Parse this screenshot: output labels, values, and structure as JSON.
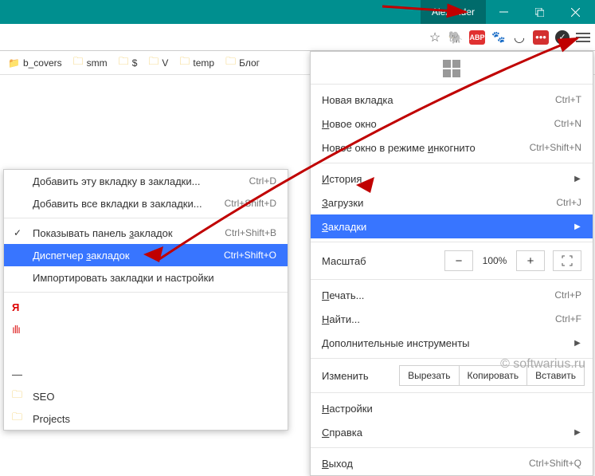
{
  "titlebar": {
    "user": "Alexander"
  },
  "bookmarks_bar": {
    "items": [
      {
        "label": "b_covers"
      },
      {
        "label": "smm"
      },
      {
        "label": "$"
      },
      {
        "label": "V"
      },
      {
        "label": "temp"
      },
      {
        "label": "Блог"
      }
    ]
  },
  "menu": {
    "new_tab": {
      "label": "Новая вкладка",
      "shortcut": "Ctrl+T"
    },
    "new_window": {
      "label": "Новое окно",
      "shortcut": "Ctrl+N"
    },
    "incognito": {
      "label": "Новое окно в режиме инкогнито",
      "shortcut": "Ctrl+Shift+N"
    },
    "history": {
      "label": "История"
    },
    "downloads": {
      "label": "Загрузки",
      "shortcut": "Ctrl+J"
    },
    "bookmarks": {
      "label": "Закладки"
    },
    "zoom": {
      "label": "Масштаб",
      "value": "100%",
      "minus": "−",
      "plus": "+"
    },
    "print": {
      "label": "Печать...",
      "shortcut": "Ctrl+P"
    },
    "find": {
      "label": "Найти...",
      "shortcut": "Ctrl+F"
    },
    "tools": {
      "label": "Дополнительные инструменты"
    },
    "edit": {
      "label": "Изменить",
      "cut": "Вырезать",
      "copy": "Копировать",
      "paste": "Вставить"
    },
    "settings": {
      "label": "Настройки"
    },
    "help": {
      "label": "Справка"
    },
    "exit": {
      "label": "Выход",
      "shortcut": "Ctrl+Shift+Q"
    }
  },
  "submenu": {
    "add_this": {
      "label": "Добавить эту вкладку в закладки...",
      "shortcut": "Ctrl+D"
    },
    "add_all": {
      "label": "Добавить все вкладки в закладки...",
      "shortcut": "Ctrl+Shift+D"
    },
    "show_bar": {
      "label": "Показывать панель закладок",
      "shortcut": "Ctrl+Shift+B"
    },
    "manager": {
      "label": "Диспетчер закладок",
      "shortcut": "Ctrl+Shift+O"
    },
    "import": {
      "label": "Импортировать закладки и настройки"
    },
    "folders": {
      "seo": "SEO",
      "projects": "Projects"
    }
  },
  "watermark": "© softwarius.ru"
}
